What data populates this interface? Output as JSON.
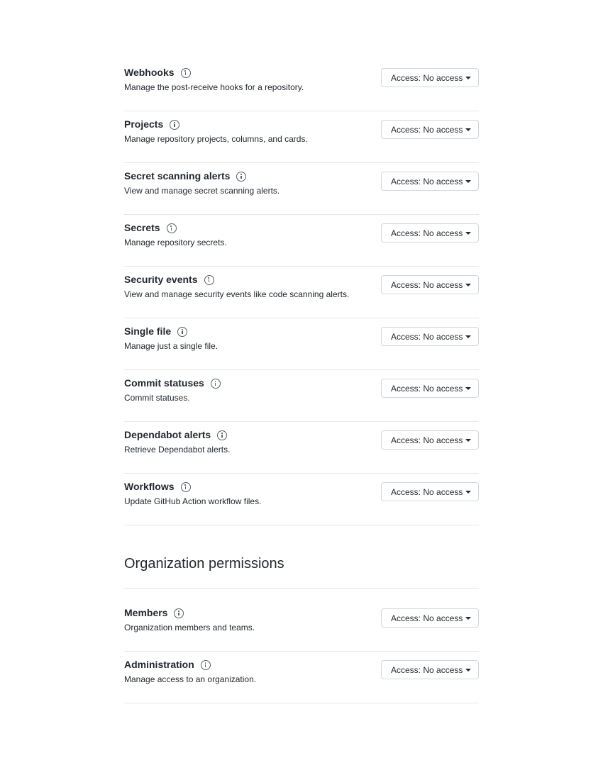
{
  "repository_permissions": [
    {
      "name": "Webhooks",
      "description": "Manage the post-receive hooks for a repository.",
      "access": "Access: No access"
    },
    {
      "name": "Projects",
      "description": "Manage repository projects, columns, and cards.",
      "access": "Access: No access"
    },
    {
      "name": "Secret scanning alerts",
      "description": "View and manage secret scanning alerts.",
      "access": "Access: No access"
    },
    {
      "name": "Secrets",
      "description": "Manage repository secrets.",
      "access": "Access: No access"
    },
    {
      "name": "Security events",
      "description": "View and manage security events like code scanning alerts.",
      "access": "Access: No access"
    },
    {
      "name": "Single file",
      "description": "Manage just a single file.",
      "access": "Access: No access"
    },
    {
      "name": "Commit statuses",
      "description": "Commit statuses.",
      "access": "Access: No access"
    },
    {
      "name": "Dependabot alerts",
      "description": "Retrieve Dependabot alerts.",
      "access": "Access: No access"
    },
    {
      "name": "Workflows",
      "description": "Update GitHub Action workflow files.",
      "access": "Access: No access"
    }
  ],
  "organization_section": {
    "heading": "Organization permissions"
  },
  "organization_permissions": [
    {
      "name": "Members",
      "description": "Organization members and teams.",
      "access": "Access: No access"
    },
    {
      "name": "Administration",
      "description": "Manage access to an organization.",
      "access": "Access: No access"
    }
  ]
}
